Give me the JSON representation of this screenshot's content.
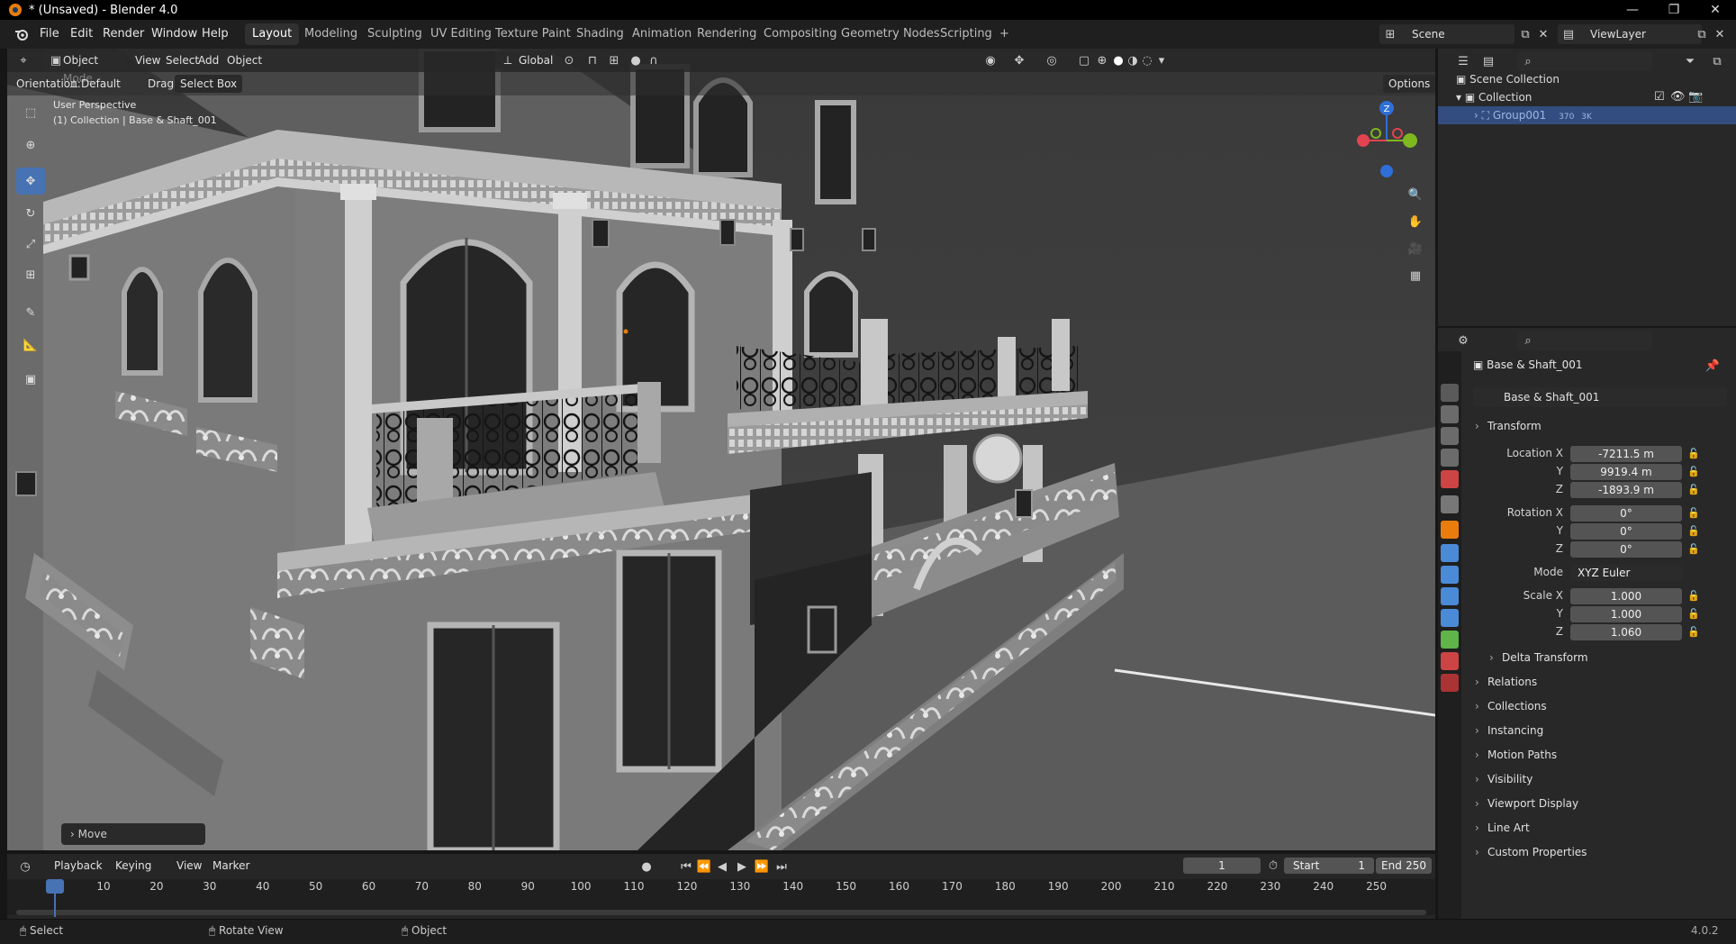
{
  "window": {
    "title": "* (Unsaved) - Blender 4.0",
    "controls": [
      "—",
      "❐",
      "✕"
    ]
  },
  "menus": [
    "File",
    "Edit",
    "Render",
    "Window",
    "Help"
  ],
  "workspaces": [
    "Layout",
    "Modeling",
    "Sculpting",
    "UV Editing",
    "Texture Paint",
    "Shading",
    "Animation",
    "Rendering",
    "Compositing",
    "Geometry Nodes",
    "Scripting",
    "+"
  ],
  "active_workspace": "Layout",
  "scene": {
    "name": "Scene",
    "view_layer": "ViewLayer"
  },
  "viewport_header": {
    "mode": "Object Mode",
    "menus": [
      "View",
      "Select",
      "Add",
      "Object"
    ],
    "transform_orientation": "Global",
    "options_label": "Options"
  },
  "tool_header": {
    "orientation_label": "Orientation:",
    "orientation_value": "Default",
    "drag_label": "Drag:",
    "drag_value": "Select Box"
  },
  "viewport_overlay": {
    "perspective": "User Perspective",
    "collection_info": "(1) Collection | Base & Shaft_001",
    "gizmo_axis": "Z",
    "last_operator": "Move"
  },
  "tools": [
    "select-box-icon",
    "cursor-icon",
    "move-icon",
    "rotate-icon",
    "scale-icon",
    "transform-icon",
    "annotate-icon",
    "measure-icon",
    "add-cube-icon"
  ],
  "active_tool": "move-icon",
  "outliner": {
    "items": [
      {
        "label": "Scene Collection",
        "indent": 0
      },
      {
        "label": "Collection",
        "indent": 1
      },
      {
        "label": "Group001",
        "indent": 2,
        "badge1": "370",
        "badge2": "3K"
      }
    ]
  },
  "properties": {
    "object_name": "Base & Shaft_001",
    "datablock_name": "Base & Shaft_001",
    "transform_title": "Transform",
    "location": {
      "label": "Location X",
      "x": "-7211.5 m",
      "y": "9919.4 m",
      "z": "-1893.9 m"
    },
    "rotation": {
      "label": "Rotation X",
      "x": "0°",
      "y": "0°",
      "z": "0°"
    },
    "mode_label": "Mode",
    "mode_value": "XYZ Euler",
    "scale": {
      "label": "Scale X",
      "x": "1.000",
      "y": "1.000",
      "z": "1.060"
    },
    "axis_labels": {
      "y": "Y",
      "z": "Z"
    },
    "subpanels": [
      "Delta Transform",
      "Relations",
      "Collections",
      "Instancing",
      "Motion Paths",
      "Visibility",
      "Viewport Display",
      "Line Art",
      "Custom Properties"
    ]
  },
  "timeline": {
    "menus": [
      "Playback",
      "Keying",
      "View",
      "Marker"
    ],
    "current_frame": "1",
    "start_label": "Start",
    "start": "1",
    "end_label": "End",
    "end": "250",
    "ticks": [
      "1",
      "10",
      "20",
      "30",
      "40",
      "50",
      "60",
      "70",
      "80",
      "90",
      "100",
      "110",
      "120",
      "130",
      "140",
      "150",
      "160",
      "170",
      "180",
      "190",
      "200",
      "210",
      "220",
      "230",
      "240",
      "250"
    ]
  },
  "statusbar": {
    "items": [
      "Select",
      "Rotate View",
      "Object"
    ],
    "version": "4.0.2"
  },
  "colors": {
    "accent": "#4772b3",
    "object_orange": "#e87d0d",
    "axis_x": "#e2434f",
    "axis_y": "#7fb71f",
    "axis_z": "#2f6fd8"
  }
}
